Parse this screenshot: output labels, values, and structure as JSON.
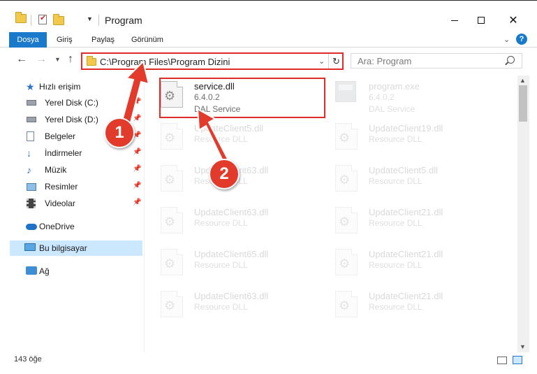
{
  "window": {
    "title": "Program",
    "status": "143 öğe"
  },
  "ribbon": {
    "tabs": [
      "Dosya",
      "Giriş",
      "Paylaş",
      "Görünüm"
    ],
    "help": "?"
  },
  "address": {
    "path": "C:\\Program Files\\Program Dizini"
  },
  "search": {
    "placeholder": "Ara: Program"
  },
  "nav": {
    "quick_access": "Hızlı erişim",
    "items": [
      {
        "label": "Yerel Disk (C:)",
        "icon": "drive-icon"
      },
      {
        "label": "Yerel Disk (D:)",
        "icon": "drive-icon"
      },
      {
        "label": "Belgeler",
        "icon": "documents-icon"
      },
      {
        "label": "İndirmeler",
        "icon": "downloads-icon"
      },
      {
        "label": "Müzik",
        "icon": "music-icon"
      },
      {
        "label": "Resimler",
        "icon": "pictures-icon"
      },
      {
        "label": "Videolar",
        "icon": "videos-icon"
      }
    ],
    "onedrive": "OneDrive",
    "this_pc": "Bu bilgisayar",
    "network": "Ağ"
  },
  "files": [
    {
      "name": "service.dll",
      "line1": "6.4.0.2",
      "line2": "DAL Service"
    },
    {
      "name": "program.exe",
      "line1": "6.4.0.2",
      "line2": "DAL Service"
    },
    {
      "name": "UpdateClient5.dll",
      "line1": "Resource DLL",
      "line2": ""
    },
    {
      "name": "UpdateClient19.dll",
      "line1": "Resource DLL",
      "line2": ""
    },
    {
      "name": "UpdateClient63.dll",
      "line1": "Resource DLL",
      "line2": ""
    },
    {
      "name": "UpdateClient5.dll",
      "line1": "Resource DLL",
      "line2": ""
    },
    {
      "name": "UpdateClient63.dll",
      "line1": "Resource DLL",
      "line2": ""
    },
    {
      "name": "UpdateClient21.dll",
      "line1": "Resource DLL",
      "line2": ""
    },
    {
      "name": "UpdateClient65.dll",
      "line1": "Resource DLL",
      "line2": ""
    },
    {
      "name": "UpdateClient21.dll",
      "line1": "Resource DLL",
      "line2": ""
    },
    {
      "name": "UpdateClient63.dll",
      "line1": "Resource DLL",
      "line2": ""
    },
    {
      "name": "UpdateClient21.dll",
      "line1": "Resource DLL",
      "line2": ""
    }
  ],
  "annotations": {
    "step1": "1",
    "step2": "2",
    "color": "#e23b2b"
  }
}
